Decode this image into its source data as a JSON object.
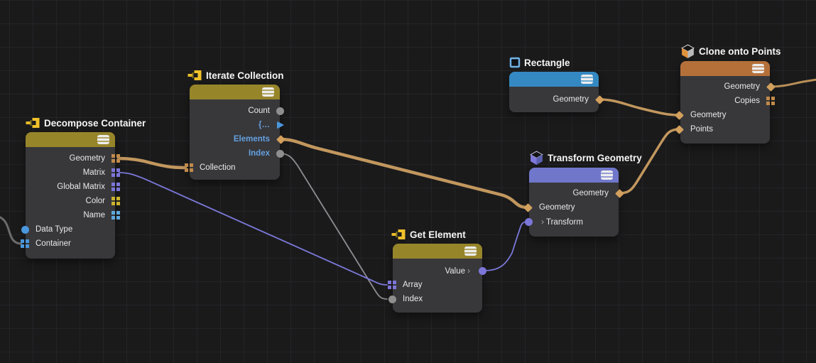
{
  "app": "node-graph-editor",
  "glyphs": {
    "chevron": "›"
  },
  "colors": {
    "background": "#1a1a1b",
    "grid_line": "#242427",
    "node_body": "#38383b",
    "header_olive": "#97852a",
    "header_blue": "#3589c2",
    "header_orange": "#b5703a",
    "header_purple": "#7077cb",
    "wire_orange": "#c2975e",
    "wire_purple": "#7c79da",
    "wire_gray": "#8d8d92",
    "port_tan_diamond": "#d2a05c",
    "port_orange_squares": "#c08a4a",
    "port_purple": "#7c76d8",
    "port_yellow_squares": "#cbb32f",
    "port_blue": "#4a97dd",
    "port_lightblue_squares": "#5fa8dc",
    "port_gray_circle": "#8e8e8e",
    "label_blue": "#64a0e0"
  },
  "nodes": [
    {
      "title": "Decompose Container",
      "icon": "collection-node-icon",
      "header_color": "#97852a",
      "rows": [
        {
          "label": "Geometry",
          "side": "out",
          "port": "squares",
          "port_color": "#c08a4a"
        },
        {
          "label": "Matrix",
          "side": "out",
          "port": "squares",
          "port_color": "#7c76d8"
        },
        {
          "label": "Global Matrix",
          "side": "out",
          "port": "squares",
          "port_color": "#7c76d8"
        },
        {
          "label": "Color",
          "side": "out",
          "port": "squares",
          "port_color": "#cbb32f"
        },
        {
          "label": "Name",
          "side": "out",
          "port": "squares",
          "port_color": "#5fa8dc"
        },
        {
          "label": "Data Type",
          "side": "in",
          "port": "circle",
          "port_color": "#4a97dd"
        },
        {
          "label": "Container",
          "side": "in",
          "port": "squares",
          "port_color": "#4a97dd"
        }
      ]
    },
    {
      "title": "Iterate Collection",
      "icon": "collection-node-icon",
      "header_color": "#97852a",
      "rows": [
        {
          "label": "Count",
          "side": "out",
          "port": "circle",
          "port_color": "#8e8e8e"
        },
        {
          "label": "{…",
          "side": "out",
          "port": "triangle",
          "port_color": "#4a97dd",
          "label_color": "#64a0e0"
        },
        {
          "label": "Elements",
          "side": "out",
          "port": "diamond",
          "port_color": "#d2a05c",
          "label_color": "#64a0e0"
        },
        {
          "label": "Index",
          "side": "out",
          "port": "circle",
          "port_color": "#8e8e8e",
          "label_color": "#64a0e0"
        },
        {
          "label": "Collection",
          "side": "in",
          "port": "squares",
          "port_color": "#c08a4a"
        }
      ]
    },
    {
      "title": "Rectangle",
      "icon": "rectangle-icon",
      "header_color": "#3589c2",
      "rows": [
        {
          "label": "Geometry",
          "side": "out",
          "port": "diamond",
          "port_color": "#d2a05c"
        }
      ]
    },
    {
      "title": "Clone onto Points",
      "icon": "cube-orange-icon",
      "header_color": "#b5703a",
      "rows": [
        {
          "label": "Geometry",
          "side": "out",
          "port": "diamond",
          "port_color": "#d2a05c"
        },
        {
          "label": "Copies",
          "side": "out",
          "port": "squares",
          "port_color": "#c08a4a"
        },
        {
          "label": "Geometry",
          "side": "in",
          "port": "diamond",
          "port_color": "#d2a05c"
        },
        {
          "label": "Points",
          "side": "in",
          "port": "diamond",
          "port_color": "#d2a05c"
        }
      ]
    },
    {
      "title": "Transform Geometry",
      "icon": "cube-purple-icon",
      "header_color": "#7077cb",
      "rows": [
        {
          "label": "Geometry",
          "side": "out",
          "port": "diamond",
          "port_color": "#d2a05c"
        },
        {
          "label": "Geometry",
          "side": "in",
          "port": "diamond",
          "port_color": "#d2a05c"
        },
        {
          "label": "Transform",
          "side": "in",
          "port": "circle",
          "port_color": "#7c76d8",
          "expander": true
        }
      ]
    },
    {
      "title": "Get Element",
      "icon": "collection-node-icon",
      "header_color": "#97852a",
      "rows": [
        {
          "label": "Value",
          "side": "out",
          "port": "circle",
          "port_color": "#7c76d8",
          "expander": true
        },
        {
          "label": "Array",
          "side": "in",
          "port": "squares",
          "port_color": "#7c76d8"
        },
        {
          "label": "Index",
          "side": "in",
          "port": "circle",
          "port_color": "#8e8e8e"
        }
      ]
    }
  ],
  "connections": [
    {
      "from": "offscreen-left",
      "to": "Decompose Container.Container",
      "color": "gray"
    },
    {
      "from": "Decompose Container.Geometry",
      "to": "Iterate Collection.Collection",
      "color": "orange"
    },
    {
      "from": "Decompose Container.Matrix",
      "to": "Get Element.Array",
      "color": "purple"
    },
    {
      "from": "Iterate Collection.Elements",
      "to": "Transform Geometry.Geometry",
      "color": "orange"
    },
    {
      "from": "Iterate Collection.Index",
      "to": "Get Element.Index",
      "color": "gray"
    },
    {
      "from": "Get Element.Value",
      "to": "Transform Geometry.Transform",
      "color": "purple"
    },
    {
      "from": "Rectangle.Geometry",
      "to": "Clone onto Points.Geometry",
      "color": "orange"
    },
    {
      "from": "Transform Geometry.Geometry",
      "to": "Clone onto Points.Points",
      "color": "orange"
    },
    {
      "from": "Clone onto Points.Geometry",
      "to": "offscreen-right",
      "color": "orange"
    }
  ]
}
